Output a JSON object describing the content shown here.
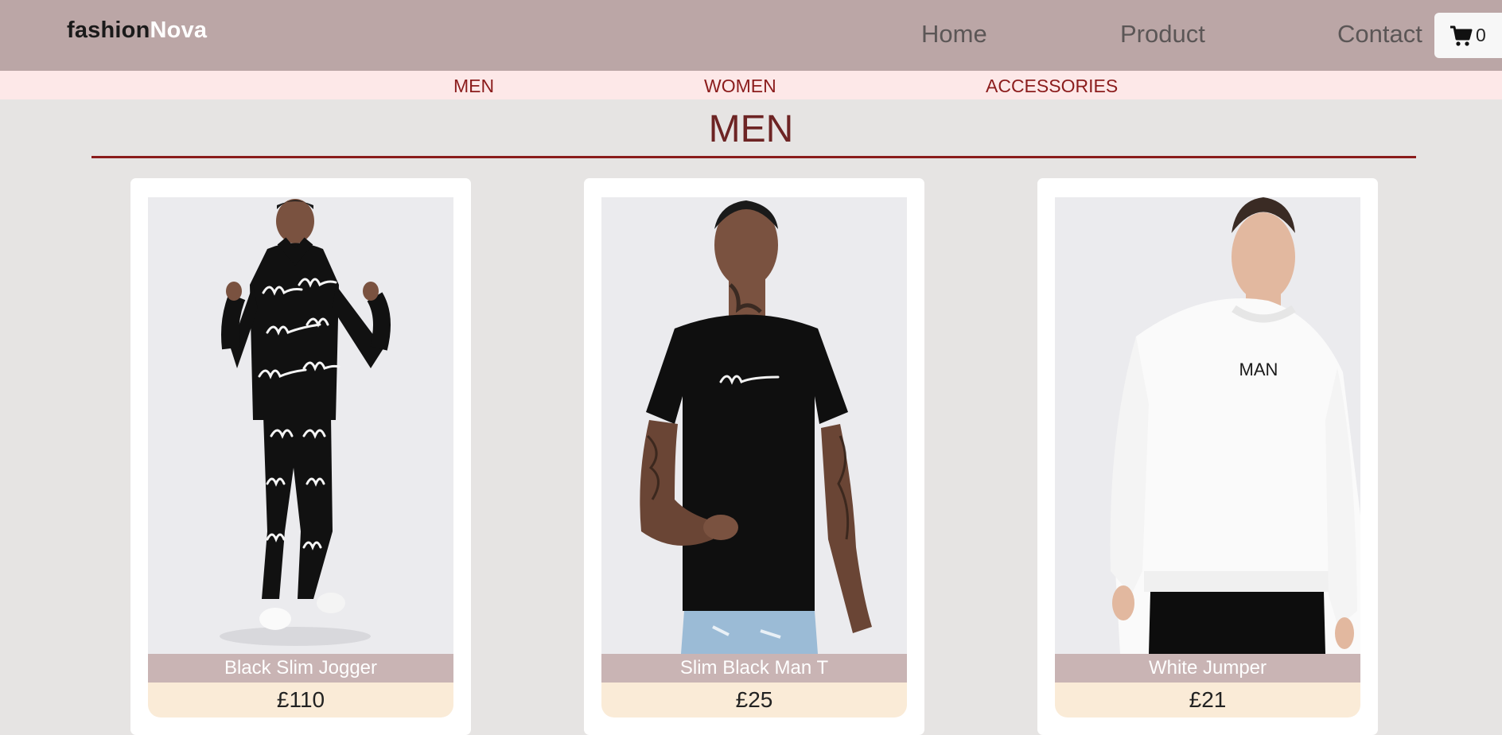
{
  "header": {
    "logo_part1": "fashion",
    "logo_part2": "Nova",
    "nav": [
      "Home",
      "Product",
      "Contact"
    ],
    "cart_icon": "shopping-cart-icon",
    "cart_count": "0"
  },
  "categories": [
    "MEN",
    "WOMEN",
    "ACCESSORIES"
  ],
  "section": {
    "title": "MEN"
  },
  "products": [
    {
      "name": "Black Slim Jogger",
      "price": "£110",
      "image": "model wearing black patterned tracksuit"
    },
    {
      "name": "Slim Black Man T",
      "price": "£25",
      "image": "model wearing black t-shirt"
    },
    {
      "name": "White Jumper",
      "price": "£21",
      "image": "model wearing white jumper",
      "print": "MAN"
    }
  ],
  "colors": {
    "header_bg": "#bba6a6",
    "category_bg": "#fde8e8",
    "accent": "#8b1c1c",
    "page_bg": "#e6e4e3",
    "name_strip": "#c9b4b4",
    "price_strip": "#faebd7"
  }
}
